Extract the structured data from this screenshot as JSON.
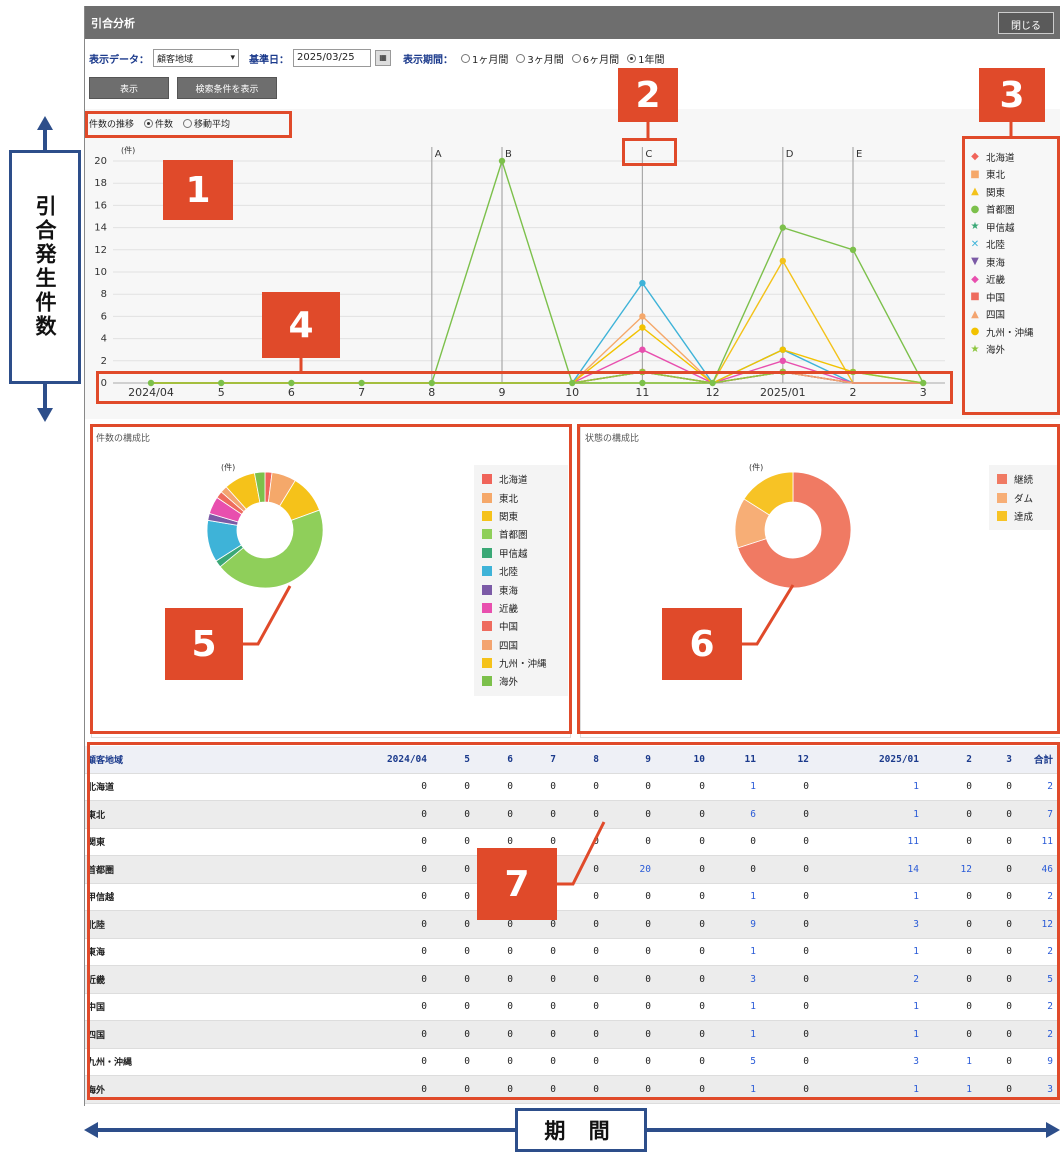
{
  "side_label": "引合発生件数",
  "bottom_label": "期 間",
  "window": {
    "title": "引合分析",
    "close_label": "閉じる"
  },
  "controls": {
    "display_data_label": "表示データ：",
    "display_data_value": "顧客地域",
    "base_date_label": "基準日：",
    "base_date_value": "2025/03/25",
    "period_label": "表示期間：",
    "periods": [
      "1ヶ月間",
      "3ヶ月間",
      "6ヶ月間",
      "1年間"
    ],
    "period_selected": "1年間",
    "show_button": "表示",
    "search_cond_button": "検索条件を表示"
  },
  "trend": {
    "label": "件数の推移",
    "options": [
      "件数",
      "移動平均"
    ],
    "selected": "件数",
    "unit": "(件)"
  },
  "annotations": [
    "1",
    "2",
    "3",
    "4",
    "5",
    "6",
    "7"
  ],
  "colors": {
    "annotation": "#e04a2a",
    "frame": "#2d4e8a",
    "link": "#2a5bd7"
  },
  "chart_data": {
    "type": "line",
    "x": [
      "2024/04",
      "5",
      "6",
      "7",
      "8",
      "9",
      "10",
      "11",
      "12",
      "2025/01",
      "2",
      "3"
    ],
    "ylim": [
      0,
      20
    ],
    "yticks": [
      0,
      2,
      4,
      6,
      8,
      10,
      12,
      14,
      16,
      18,
      20
    ],
    "markers": [
      {
        "label": "A",
        "x": "8"
      },
      {
        "label": "B",
        "x": "9"
      },
      {
        "label": "C",
        "x": "11"
      },
      {
        "label": "D",
        "x": "2025/01"
      },
      {
        "label": "E",
        "x": "2"
      }
    ],
    "series": [
      {
        "name": "北海道",
        "color": "#f0645a",
        "symbol": "◆",
        "values": [
          0,
          0,
          0,
          0,
          0,
          0,
          0,
          1,
          0,
          1,
          0,
          0
        ]
      },
      {
        "name": "東北",
        "color": "#f5a86a",
        "symbol": "■",
        "values": [
          0,
          0,
          0,
          0,
          0,
          0,
          0,
          6,
          0,
          1,
          0,
          0
        ]
      },
      {
        "name": "関東",
        "color": "#f3c21a",
        "symbol": "▲",
        "values": [
          0,
          0,
          0,
          0,
          0,
          0,
          0,
          0,
          0,
          11,
          0,
          0
        ]
      },
      {
        "name": "首都圏",
        "color": "#7cc04b",
        "symbol": "●",
        "values": [
          0,
          0,
          0,
          0,
          0,
          20,
          0,
          0,
          0,
          14,
          12,
          0
        ]
      },
      {
        "name": "甲信越",
        "color": "#3aa876",
        "symbol": "★",
        "values": [
          0,
          0,
          0,
          0,
          0,
          0,
          0,
          1,
          0,
          1,
          0,
          0
        ]
      },
      {
        "name": "北陸",
        "color": "#3eb3d8",
        "symbol": "✕",
        "values": [
          0,
          0,
          0,
          0,
          0,
          0,
          0,
          9,
          0,
          3,
          0,
          0
        ]
      },
      {
        "name": "東海",
        "color": "#7b5aa6",
        "symbol": "▼",
        "values": [
          0,
          0,
          0,
          0,
          0,
          0,
          0,
          1,
          0,
          1,
          0,
          0
        ]
      },
      {
        "name": "近畿",
        "color": "#e84fae",
        "symbol": "◆",
        "values": [
          0,
          0,
          0,
          0,
          0,
          0,
          0,
          3,
          0,
          2,
          0,
          0
        ]
      },
      {
        "name": "中国",
        "color": "#ee6b5e",
        "symbol": "■",
        "values": [
          0,
          0,
          0,
          0,
          0,
          0,
          0,
          1,
          0,
          1,
          0,
          0
        ]
      },
      {
        "name": "四国",
        "color": "#f3a470",
        "symbol": "▲",
        "values": [
          0,
          0,
          0,
          0,
          0,
          0,
          0,
          1,
          0,
          1,
          0,
          0
        ]
      },
      {
        "name": "九州・沖縄",
        "color": "#f2c200",
        "symbol": "●",
        "values": [
          0,
          0,
          0,
          0,
          0,
          0,
          0,
          5,
          0,
          3,
          1,
          0
        ]
      },
      {
        "name": "海外",
        "color": "#8dc63f",
        "symbol": "★",
        "values": [
          0,
          0,
          0,
          0,
          0,
          0,
          0,
          1,
          0,
          1,
          1,
          0
        ]
      }
    ]
  },
  "pie_count": {
    "title": "件数の構成比",
    "unit": "(件)",
    "slices": [
      {
        "name": "北海道",
        "value": 2,
        "color": "#f0645a"
      },
      {
        "name": "東北",
        "value": 7,
        "color": "#f5a86a"
      },
      {
        "name": "関東",
        "value": 11,
        "color": "#f5c21a"
      },
      {
        "name": "首都圏",
        "value": 46,
        "color": "#8fcf5a"
      },
      {
        "name": "甲信越",
        "value": 2,
        "color": "#3aa876"
      },
      {
        "name": "北陸",
        "value": 12,
        "color": "#3eb3d8"
      },
      {
        "name": "東海",
        "value": 2,
        "color": "#7b5aa6"
      },
      {
        "name": "近畿",
        "value": 5,
        "color": "#e84fae"
      },
      {
        "name": "中国",
        "value": 2,
        "color": "#ee6b5e"
      },
      {
        "name": "四国",
        "value": 2,
        "color": "#f3a470"
      },
      {
        "name": "九州・沖縄",
        "value": 9,
        "color": "#f5c21a"
      },
      {
        "name": "海外",
        "value": 3,
        "color": "#7cc04b"
      }
    ]
  },
  "pie_status": {
    "title": "状態の構成比",
    "unit": "(件)",
    "slices": [
      {
        "name": "継続",
        "value": 70,
        "color": "#f07a63"
      },
      {
        "name": "ダム",
        "value": 14,
        "color": "#f7ae76"
      },
      {
        "name": "達成",
        "value": 16,
        "color": "#f7c325"
      }
    ]
  },
  "table": {
    "header": [
      "顧客地域",
      "2024/04",
      "5",
      "6",
      "7",
      "8",
      "9",
      "10",
      "11",
      "12",
      "2025/01",
      "2",
      "3",
      "合計"
    ],
    "rows": [
      [
        "北海道",
        "0",
        "0",
        "0",
        "0",
        "0",
        "0",
        "0",
        "1",
        "0",
        "1",
        "0",
        "0",
        "2"
      ],
      [
        "東北",
        "0",
        "0",
        "0",
        "0",
        "0",
        "0",
        "0",
        "6",
        "0",
        "1",
        "0",
        "0",
        "7"
      ],
      [
        "関東",
        "0",
        "0",
        "0",
        "0",
        "0",
        "0",
        "0",
        "0",
        "0",
        "11",
        "0",
        "0",
        "11"
      ],
      [
        "首都圏",
        "0",
        "0",
        "0",
        "0",
        "0",
        "20",
        "0",
        "0",
        "0",
        "14",
        "12",
        "0",
        "46"
      ],
      [
        "甲信越",
        "0",
        "0",
        "0",
        "0",
        "0",
        "0",
        "0",
        "1",
        "0",
        "1",
        "0",
        "0",
        "2"
      ],
      [
        "北陸",
        "0",
        "0",
        "0",
        "0",
        "0",
        "0",
        "0",
        "9",
        "0",
        "3",
        "0",
        "0",
        "12"
      ],
      [
        "東海",
        "0",
        "0",
        "0",
        "0",
        "0",
        "0",
        "0",
        "1",
        "0",
        "1",
        "0",
        "0",
        "2"
      ],
      [
        "近畿",
        "0",
        "0",
        "0",
        "0",
        "0",
        "0",
        "0",
        "3",
        "0",
        "2",
        "0",
        "0",
        "5"
      ],
      [
        "中国",
        "0",
        "0",
        "0",
        "0",
        "0",
        "0",
        "0",
        "1",
        "0",
        "1",
        "0",
        "0",
        "2"
      ],
      [
        "四国",
        "0",
        "0",
        "0",
        "0",
        "0",
        "0",
        "0",
        "1",
        "0",
        "1",
        "0",
        "0",
        "2"
      ],
      [
        "九州・沖縄",
        "0",
        "0",
        "0",
        "0",
        "0",
        "0",
        "0",
        "5",
        "0",
        "3",
        "1",
        "0",
        "9"
      ],
      [
        "海外",
        "0",
        "0",
        "0",
        "0",
        "0",
        "0",
        "0",
        "1",
        "0",
        "1",
        "1",
        "0",
        "3"
      ]
    ]
  }
}
